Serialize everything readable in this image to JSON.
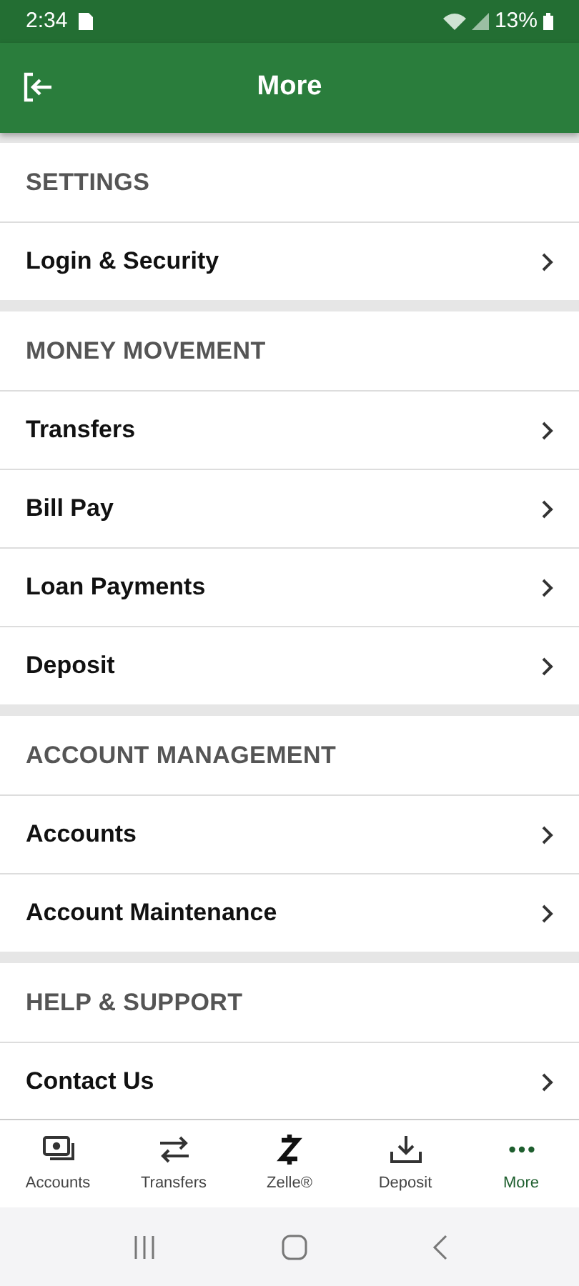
{
  "status_bar": {
    "time": "2:34",
    "battery": "13%"
  },
  "header": {
    "title": "More"
  },
  "sections": [
    {
      "title": "SETTINGS",
      "items": [
        "Login & Security"
      ]
    },
    {
      "title": "MONEY MOVEMENT",
      "items": [
        "Transfers",
        "Bill Pay",
        "Loan Payments",
        "Deposit"
      ]
    },
    {
      "title": "ACCOUNT MANAGEMENT",
      "items": [
        "Accounts",
        "Account Maintenance"
      ]
    },
    {
      "title": "HELP & SUPPORT",
      "items": [
        "Contact Us"
      ]
    }
  ],
  "bottom_nav": [
    {
      "label": "Accounts",
      "kind": "accounts",
      "selected": false
    },
    {
      "label": "Transfers",
      "kind": "transfers",
      "selected": false
    },
    {
      "label": "Zelle®",
      "kind": "zelle",
      "selected": false
    },
    {
      "label": "Deposit",
      "kind": "deposit",
      "selected": false
    },
    {
      "label": "More",
      "kind": "more",
      "selected": true
    }
  ]
}
